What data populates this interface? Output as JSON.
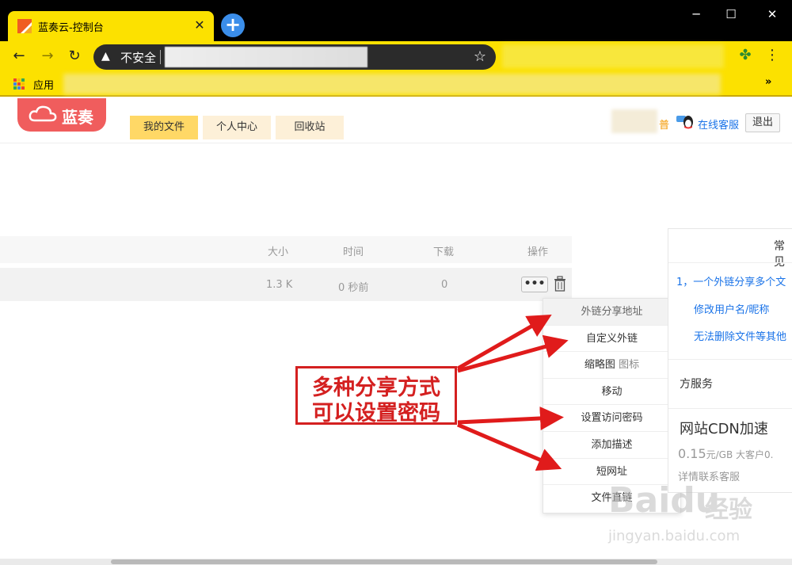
{
  "browser": {
    "tab_title": "蓝奏云-控制台",
    "new_tab_symbol": "+",
    "security_label": "不安全",
    "bookmarks_apps_label": "应用",
    "bookmarks_more": "»"
  },
  "site": {
    "logo_text": "蓝奏",
    "nav": [
      "我的文件",
      "个人中心",
      "回收站"
    ],
    "user_level": "普",
    "support_label": "在线客服",
    "logout_label": "退出"
  },
  "table": {
    "headers": [
      "大小",
      "时间",
      "下载",
      "操作"
    ],
    "row": {
      "size": "1.3 K",
      "time": "0 秒前",
      "downloads": "0",
      "more": "•••"
    }
  },
  "dropdown": {
    "header": "外链分享地址",
    "items": [
      {
        "label": "自定义外链",
        "sub": ""
      },
      {
        "label": "缩略图",
        "sub": " 图标"
      },
      {
        "label": "移动",
        "sub": ""
      },
      {
        "label": "设置访问密码",
        "sub": ""
      },
      {
        "label": "添加描述",
        "sub": ""
      },
      {
        "label": "短网址",
        "sub": ""
      },
      {
        "label": "文件直链",
        "sub": ""
      }
    ]
  },
  "right_panel": {
    "title": "常见",
    "faq": [
      "1，一个外链分享多个文",
      "修改用户名/昵称",
      "无法删除文件等其他"
    ],
    "service": "方服务",
    "cdn_title": "网站CDN加速",
    "price_prefix": "0.15",
    "price_unit": "元/GB",
    "price_tail": " 大客户0.",
    "contact": "详情联系客服"
  },
  "annotation": {
    "line1": "多种分享方式",
    "line2": "可以设置密码",
    "color": "#d42020"
  },
  "watermark": {
    "brand": "Baidu",
    "product": "经验",
    "url": "jingyan.baidu.com"
  }
}
